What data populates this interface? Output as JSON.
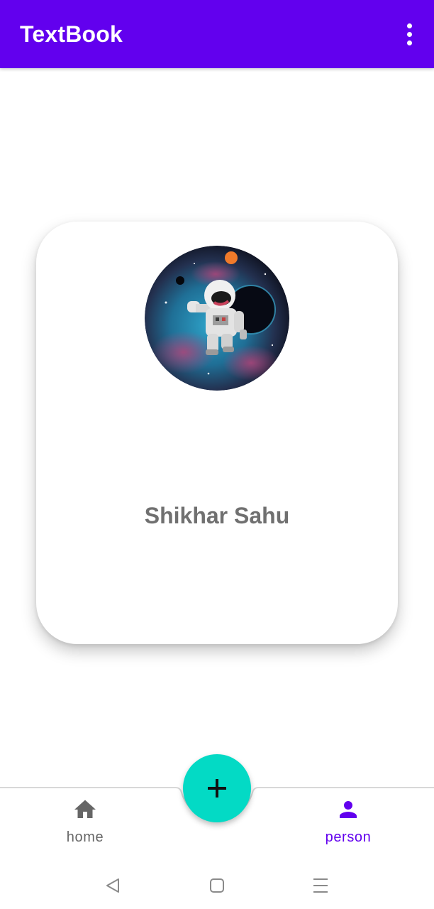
{
  "app": {
    "title": "TextBook",
    "accent_color": "#6200ee",
    "secondary_color": "#03dac5"
  },
  "toolbar": {
    "overflow_icon": "more-vert-icon"
  },
  "profile": {
    "name": "Shikhar Sahu",
    "avatar_description": "astronaut-in-space-avatar"
  },
  "bottom_nav": {
    "items": [
      {
        "label": "home",
        "icon": "home-icon",
        "selected": false
      },
      {
        "label": "person",
        "icon": "person-icon",
        "selected": true
      }
    ],
    "fab_icon": "plus-icon"
  },
  "system_nav": {
    "buttons": [
      "back-icon",
      "home-square-icon",
      "menu-lines-icon"
    ]
  }
}
